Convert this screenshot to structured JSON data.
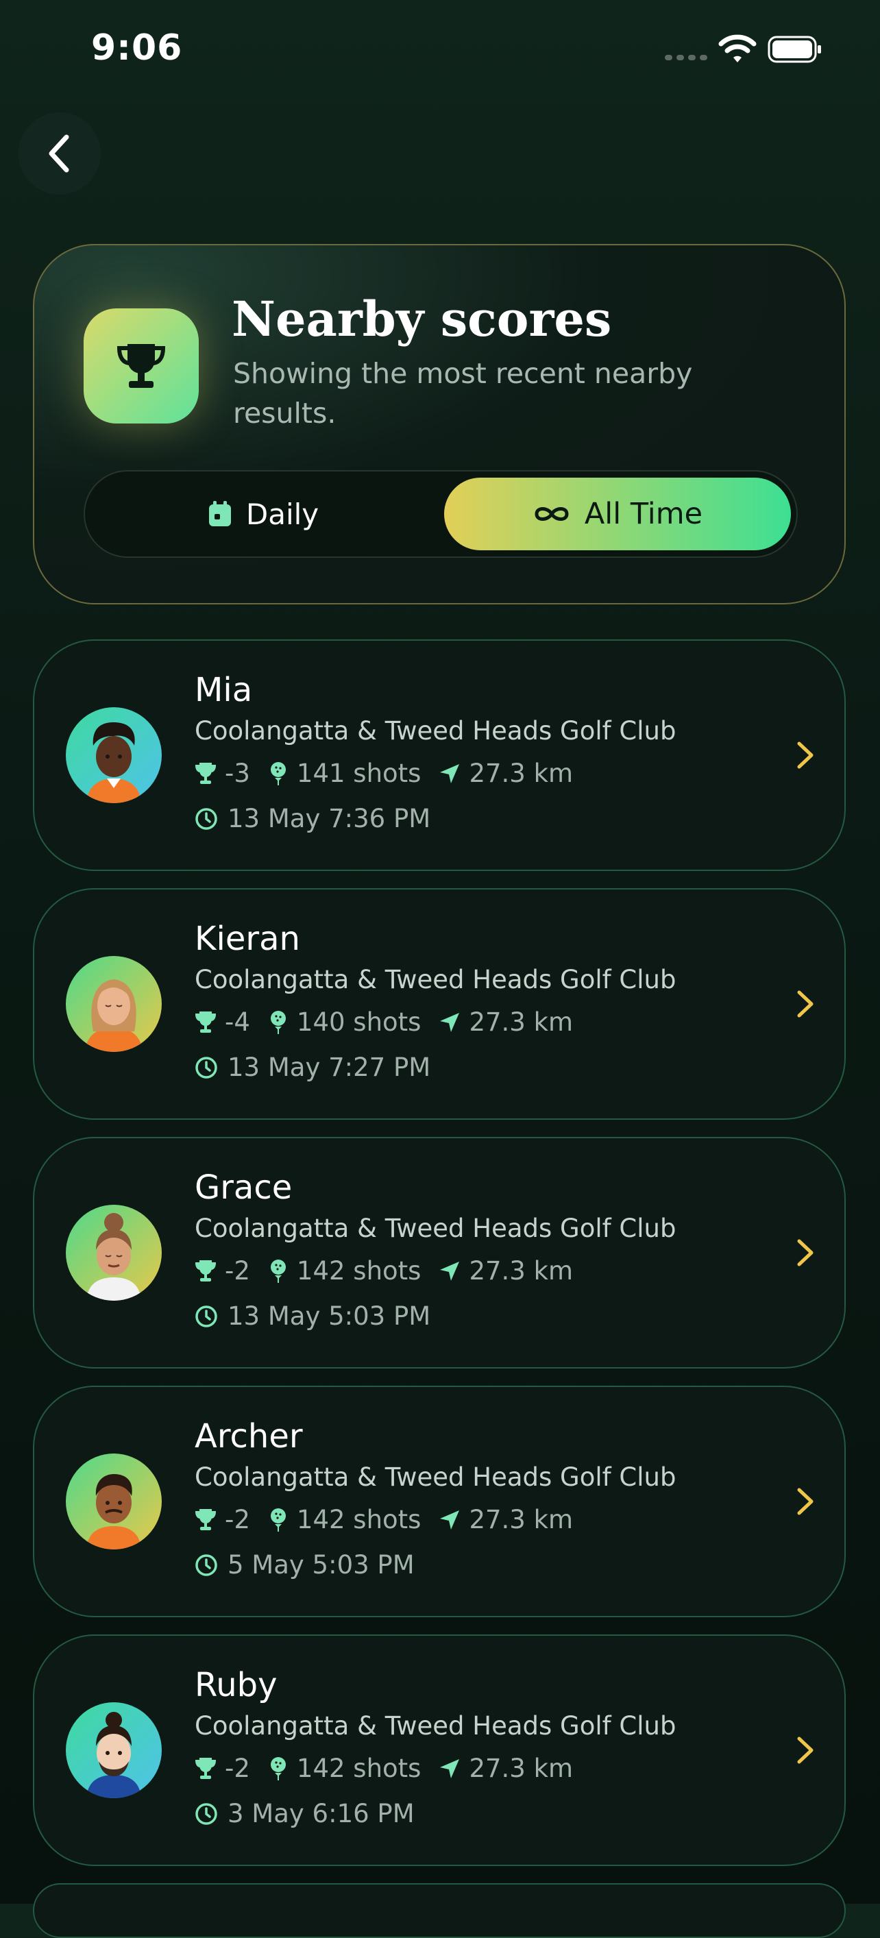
{
  "status": {
    "time": "9:06"
  },
  "header": {
    "title": "Nearby scores",
    "subtitle": "Showing the most recent nearby results.",
    "tabs": {
      "daily": "Daily",
      "all_time": "All Time",
      "selected": "All Time"
    }
  },
  "colors": {
    "accent_yellow": "#e2cf57",
    "accent_green": "#3ddf93",
    "mint": "#7fe6b8"
  },
  "scores": [
    {
      "name": "Mia",
      "club": "Coolangatta & Tweed Heads Golf Club",
      "score": "-3",
      "shots": "141 shots",
      "distance": "27.3 km",
      "date": "13 May 7:36 PM"
    },
    {
      "name": "Kieran",
      "club": "Coolangatta & Tweed Heads Golf Club",
      "score": "-4",
      "shots": "140 shots",
      "distance": "27.3 km",
      "date": "13 May 7:27 PM"
    },
    {
      "name": "Grace",
      "club": "Coolangatta & Tweed Heads Golf Club",
      "score": "-2",
      "shots": "142 shots",
      "distance": "27.3 km",
      "date": "13 May 5:03 PM"
    },
    {
      "name": "Archer",
      "club": "Coolangatta & Tweed Heads Golf Club",
      "score": "-2",
      "shots": "142 shots",
      "distance": "27.3 km",
      "date": "5 May 5:03 PM"
    },
    {
      "name": "Ruby",
      "club": "Coolangatta & Tweed Heads Golf Club",
      "score": "-2",
      "shots": "142 shots",
      "distance": "27.3 km",
      "date": "3 May 6:16 PM"
    }
  ]
}
